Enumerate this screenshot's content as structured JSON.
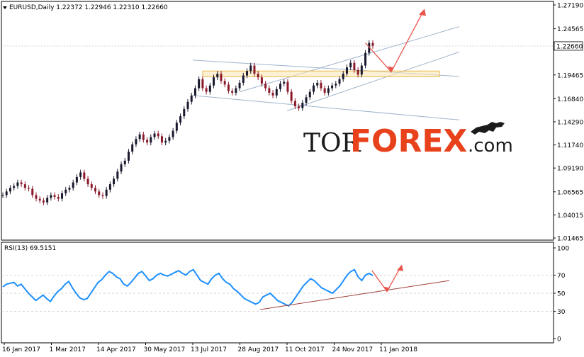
{
  "main_title": "EURUSD,Daily  1.22372  1.22946  1.22310  1.22660",
  "rsi_title": "RSI(13) 69.5151",
  "watermark": {
    "part1": "TOR",
    "part2": "FOREX",
    "part3": ".com",
    "logo_icon": "bull-icon"
  },
  "colors": {
    "bull_candle": "#1a1a2e",
    "bear_candle": "#8b1a2a",
    "rsi_line": "#1e90ff",
    "channel_line": "#9fb4cc",
    "arrow": "#e8554c",
    "rsi_trend": "#a0403a",
    "support_zone_fill": "#fbe6b0",
    "support_zone_stroke": "#e8b64a",
    "watermark_orange": "#e8421c"
  },
  "chart_data": [
    {
      "type": "candlestick",
      "symbol": "EURUSD",
      "timeframe": "Daily",
      "last_price": "1.22660",
      "ylim": [
        1.02,
        1.27
      ],
      "price_tick_labels": [
        "1.27190",
        "1.24565",
        "1.22015",
        "1.19465",
        "1.16840",
        "1.14290",
        "1.11740",
        "1.09190",
        "1.06565",
        "1.04015",
        "1.01465"
      ],
      "date_tick_labels": [
        "16 Jan 2017",
        "1 Mar 2017",
        "14 Apr 2017",
        "30 May 2017",
        "13 Jul 2017",
        "28 Aug 2017",
        "11 Oct 2017",
        "24 Nov 2017",
        "11 Jan 2018"
      ],
      "close_series": [
        1.062,
        1.066,
        1.07,
        1.072,
        1.076,
        1.074,
        1.07,
        1.069,
        1.062,
        1.058,
        1.056,
        1.054,
        1.059,
        1.062,
        1.06,
        1.058,
        1.064,
        1.068,
        1.07,
        1.076,
        1.082,
        1.087,
        1.08,
        1.074,
        1.07,
        1.066,
        1.062,
        1.061,
        1.068,
        1.074,
        1.08,
        1.088,
        1.096,
        1.1,
        1.11,
        1.118,
        1.124,
        1.129,
        1.123,
        1.12,
        1.126,
        1.13,
        1.127,
        1.12,
        1.122,
        1.126,
        1.133,
        1.142,
        1.149,
        1.157,
        1.165,
        1.172,
        1.18,
        1.19,
        1.18,
        1.176,
        1.183,
        1.192,
        1.196,
        1.188,
        1.184,
        1.177,
        1.175,
        1.18,
        1.186,
        1.194,
        1.199,
        1.205,
        1.196,
        1.192,
        1.185,
        1.18,
        1.175,
        1.172,
        1.179,
        1.185,
        1.187,
        1.176,
        1.166,
        1.16,
        1.158,
        1.164,
        1.17,
        1.176,
        1.183,
        1.186,
        1.18,
        1.175,
        1.18,
        1.183,
        1.185,
        1.19,
        1.196,
        1.203,
        1.208,
        1.2,
        1.195,
        1.205,
        1.219,
        1.23,
        1.2266
      ],
      "overlays": [
        {
          "kind": "ascending-channel-upper",
          "from": [
            "28 Aug 2017",
            1.176
          ],
          "to": [
            "11 Jan 2018",
            1.248
          ]
        },
        {
          "kind": "ascending-channel-lower",
          "from": [
            "11 Oct 2017",
            1.155
          ],
          "to": [
            "11 Jan 2018",
            1.22
          ]
        },
        {
          "kind": "descending-channel-upper",
          "from": [
            "13 Jul 2017",
            1.211
          ],
          "to": [
            "11 Jan 2018",
            1.193
          ]
        },
        {
          "kind": "descending-channel-lower",
          "from": [
            "13 Jul 2017",
            1.172
          ],
          "to": [
            "11 Jan 2018",
            1.145
          ]
        },
        {
          "kind": "support-zone",
          "price_range": [
            1.193,
            1.199
          ]
        },
        {
          "kind": "forecast-arrow",
          "path": [
            1.23,
            1.198,
            1.266
          ]
        }
      ]
    },
    {
      "type": "line",
      "indicator": "RSI",
      "period": 13,
      "last_value": 69.5151,
      "ylim": [
        0,
        100
      ],
      "tick_labels": [
        "100",
        "70",
        "50",
        "30",
        "0"
      ],
      "values": [
        57,
        60,
        61,
        62,
        58,
        60,
        55,
        50,
        46,
        42,
        45,
        48,
        44,
        41,
        47,
        52,
        55,
        60,
        63,
        56,
        50,
        45,
        43,
        44,
        50,
        56,
        62,
        65,
        70,
        74,
        72,
        68,
        66,
        60,
        58,
        62,
        67,
        72,
        74,
        69,
        64,
        66,
        70,
        72,
        70,
        69,
        71,
        73,
        75,
        72,
        70,
        74,
        76,
        70,
        64,
        62,
        60,
        66,
        70,
        72,
        66,
        62,
        60,
        55,
        52,
        48,
        44,
        42,
        40,
        38,
        40,
        46,
        48,
        50,
        46,
        42,
        40,
        38,
        36,
        40,
        46,
        52,
        58,
        62,
        66,
        64,
        60,
        56,
        54,
        52,
        50,
        54,
        58,
        64,
        70,
        74,
        76,
        68,
        64,
        70,
        72,
        69.5
      ],
      "overlays": [
        {
          "kind": "rsi-support-trendline",
          "from": [
            "11 Oct 2017",
            32
          ],
          "to": [
            "11 Jan 2018",
            64
          ]
        },
        {
          "kind": "forecast-arrow",
          "path": [
            75,
            52,
            80
          ]
        }
      ]
    }
  ]
}
